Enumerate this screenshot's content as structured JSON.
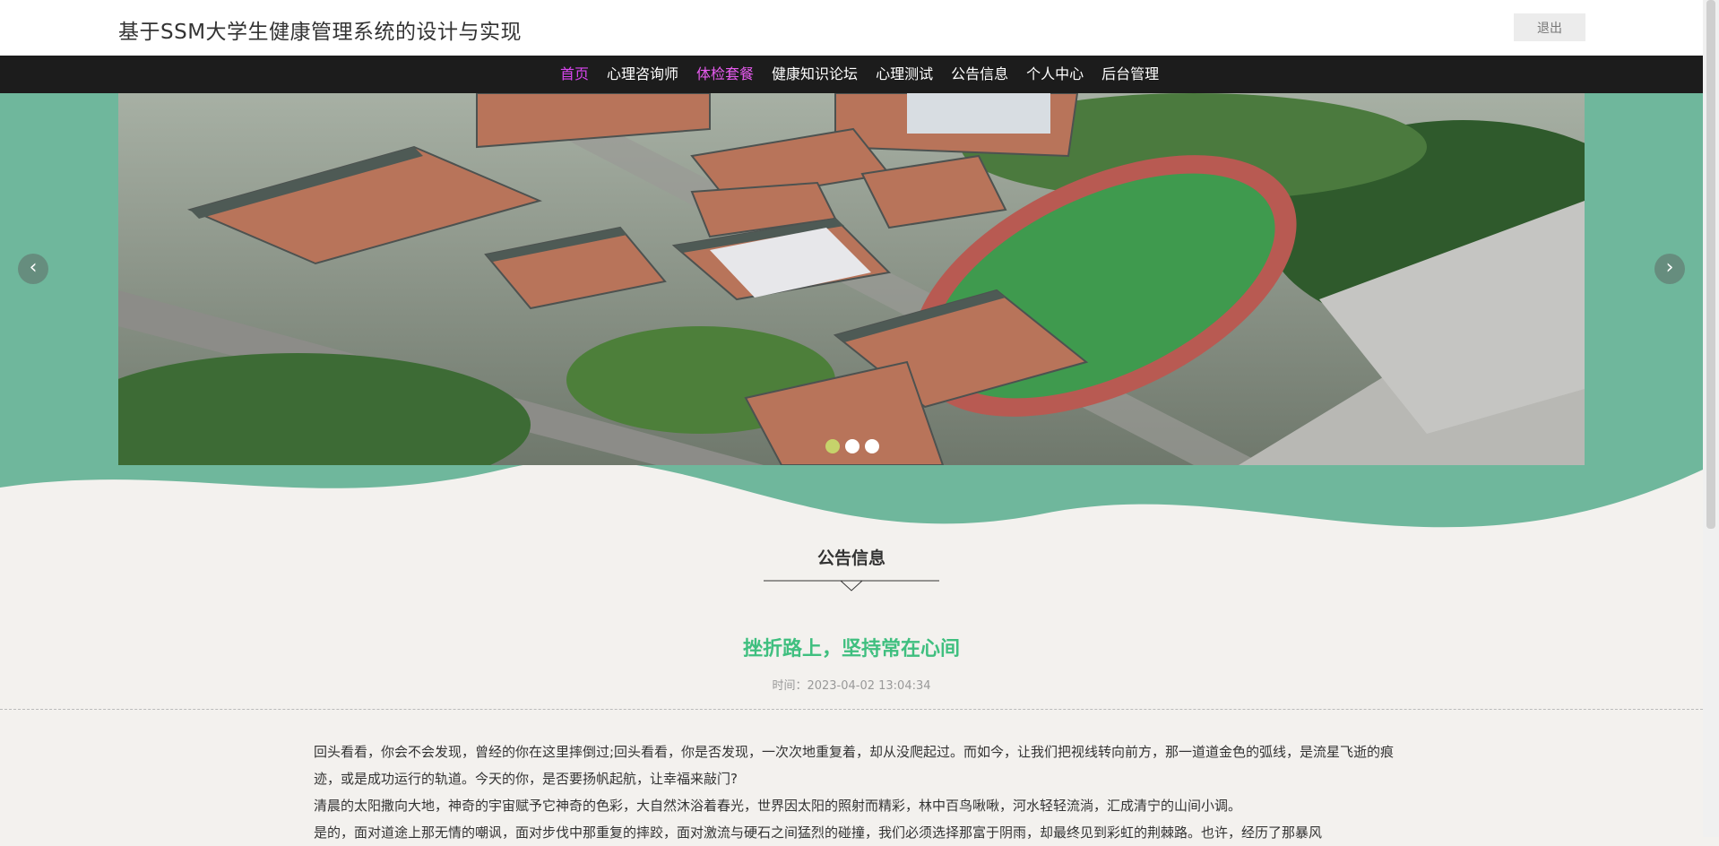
{
  "header": {
    "site_title": "基于SSM大学生健康管理系统的设计与实现",
    "logout_label": "退出"
  },
  "nav": {
    "items": [
      {
        "label": "首页"
      },
      {
        "label": "心理咨询师"
      },
      {
        "label": "体检套餐"
      },
      {
        "label": "健康知识论坛"
      },
      {
        "label": "心理测试"
      },
      {
        "label": "公告信息"
      },
      {
        "label": "个人中心"
      },
      {
        "label": "后台管理"
      }
    ]
  },
  "carousel": {
    "arrow_left": "‹",
    "arrow_right": "›",
    "slide_count": 3,
    "active_index": 0
  },
  "section": {
    "title": "公告信息"
  },
  "notice": {
    "title": "挫折路上，坚持常在心间",
    "time": "时间：2023-04-02 13:04:34",
    "paragraphs": [
      "回头看看，你会不会发现，曾经的你在这里摔倒过;回头看看，你是否发现，一次次地重复着，却从没爬起过。而如今，让我们把视线转向前方，那一道道金色的弧线，是流星飞逝的痕迹，或是成功运行的轨道。今天的你，是否要扬帆起航，让幸福来敲门?",
      "清晨的太阳撒向大地，神奇的宇宙赋予它神奇的色彩，大自然沐浴着春光，世界因太阳的照射而精彩，林中百鸟啾啾，河水轻轻流淌，汇成清宁的山间小调。",
      "是的，面对道途上那无情的嘲讽，面对步伐中那重复的摔跤，面对激流与硬石之间猛烈的碰撞，我们必须选择那富于阴雨，却最终见到彩虹的荆棘路。也许，经历了那暴风"
    ]
  },
  "colors": {
    "nav_bg": "#1c1c1c",
    "nav_active": "#d946ef",
    "accent_green": "#3fbf7f",
    "banner_green": "#6fb79c"
  }
}
